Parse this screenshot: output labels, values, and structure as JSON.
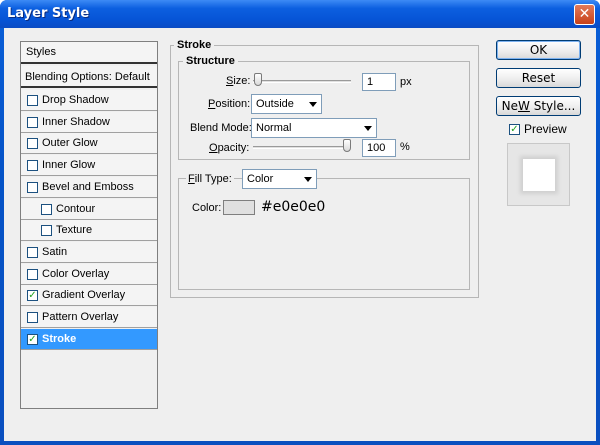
{
  "window": {
    "title": "Layer Style",
    "close_glyph": "✕"
  },
  "styles_panel": {
    "header": "Styles",
    "blending_options": "Blending Options: Default",
    "items": [
      {
        "label": "Drop Shadow",
        "checked": false,
        "indent": false,
        "selected": false
      },
      {
        "label": "Inner Shadow",
        "checked": false,
        "indent": false,
        "selected": false
      },
      {
        "label": "Outer Glow",
        "checked": false,
        "indent": false,
        "selected": false
      },
      {
        "label": "Inner Glow",
        "checked": false,
        "indent": false,
        "selected": false
      },
      {
        "label": "Bevel and Emboss",
        "checked": false,
        "indent": false,
        "selected": false
      },
      {
        "label": "Contour",
        "checked": false,
        "indent": true,
        "selected": false
      },
      {
        "label": "Texture",
        "checked": false,
        "indent": true,
        "selected": false
      },
      {
        "label": "Satin",
        "checked": false,
        "indent": false,
        "selected": false
      },
      {
        "label": "Color Overlay",
        "checked": false,
        "indent": false,
        "selected": false
      },
      {
        "label": "Gradient Overlay",
        "checked": true,
        "indent": false,
        "selected": false
      },
      {
        "label": "Pattern Overlay",
        "checked": false,
        "indent": false,
        "selected": false
      },
      {
        "label": "Stroke",
        "checked": true,
        "indent": false,
        "selected": true
      }
    ]
  },
  "stroke": {
    "group_title": "Stroke",
    "structure_title": "Structure",
    "size": {
      "label_pre": "",
      "label_key": "S",
      "label_post": "ize:",
      "value": "1",
      "unit": "px",
      "slider_fraction": 0.01
    },
    "position": {
      "label_key": "P",
      "label_post": "osition:",
      "value": "Outside"
    },
    "blend_mode": {
      "label_pre": "Blend Mode:",
      "value": "Normal"
    },
    "opacity": {
      "label_key": "O",
      "label_post": "pacity:",
      "value": "100",
      "unit": "%",
      "slider_fraction": 1.0
    },
    "fill_type": {
      "label_key": "F",
      "label_post": "ill Type:",
      "value": "Color"
    },
    "color": {
      "label": "Color:",
      "swatch": "#e0e0e0",
      "hex_text": "#e0e0e0"
    }
  },
  "buttons": {
    "ok": "OK",
    "reset": "Reset",
    "new_style_key": "W",
    "new_style_pre": "Ne",
    "new_style_post": " Style...",
    "preview_label": "Preview",
    "preview_checked": true
  }
}
